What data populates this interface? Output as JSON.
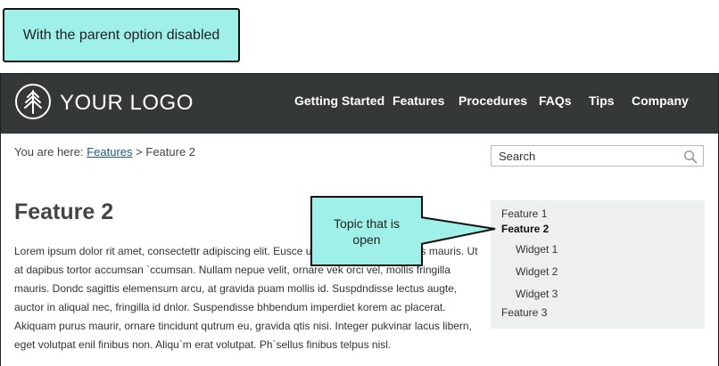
{
  "annotations": {
    "top_callout": "With the parent option disabled",
    "topic_callout_line1": "Topic that is",
    "topic_callout_line2": "open"
  },
  "header": {
    "logo_text": "YOUR LOGO",
    "nav": [
      "Getting Started",
      "Features",
      "Procedures",
      "FAQs",
      "Tips",
      "Company"
    ]
  },
  "breadcrumb": {
    "prefix": "You are here:",
    "link": "Features",
    "separator": ">",
    "current": "Feature 2"
  },
  "search": {
    "placeholder": "Search"
  },
  "main": {
    "title": "Feature 2",
    "body": "Lorem ipsum dolor rit amet, consectettr adipiscing elit. Eusce ut ultrices nulla, in cursus mauris. Ut at dapibus tortor accumsan `ccumsan. Nullam nepue velit, ornare vek orci vel, mollis fringilla mauris. Dondc sagittis elemensum arcu, at gravida puam mollis id. Suspdndisse lectus augte, auctor in aliqual nec, fringilla id dnlor. Suspendisse bhbendum imperdiet korem ac placerat. Akiquam purus maurir, ornare tincidunt qutrum eu, gravida qtis nisi. Integer pukvinar lacus libern, eget volutpat enil finibus non. Aliqu`m erat volutpat. Ph`sellus finibus telpus nisl."
  },
  "side_nav": {
    "items": [
      "Feature 1",
      "Feature 2",
      "Widget 1",
      "Widget 2",
      "Widget 3",
      "Feature 3"
    ],
    "active": "Feature 2"
  },
  "colors": {
    "header_bg": "#343839",
    "callout_bg": "#9ff0e8",
    "link": "#1a5a85",
    "side_nav_bg": "#eef0ef"
  }
}
